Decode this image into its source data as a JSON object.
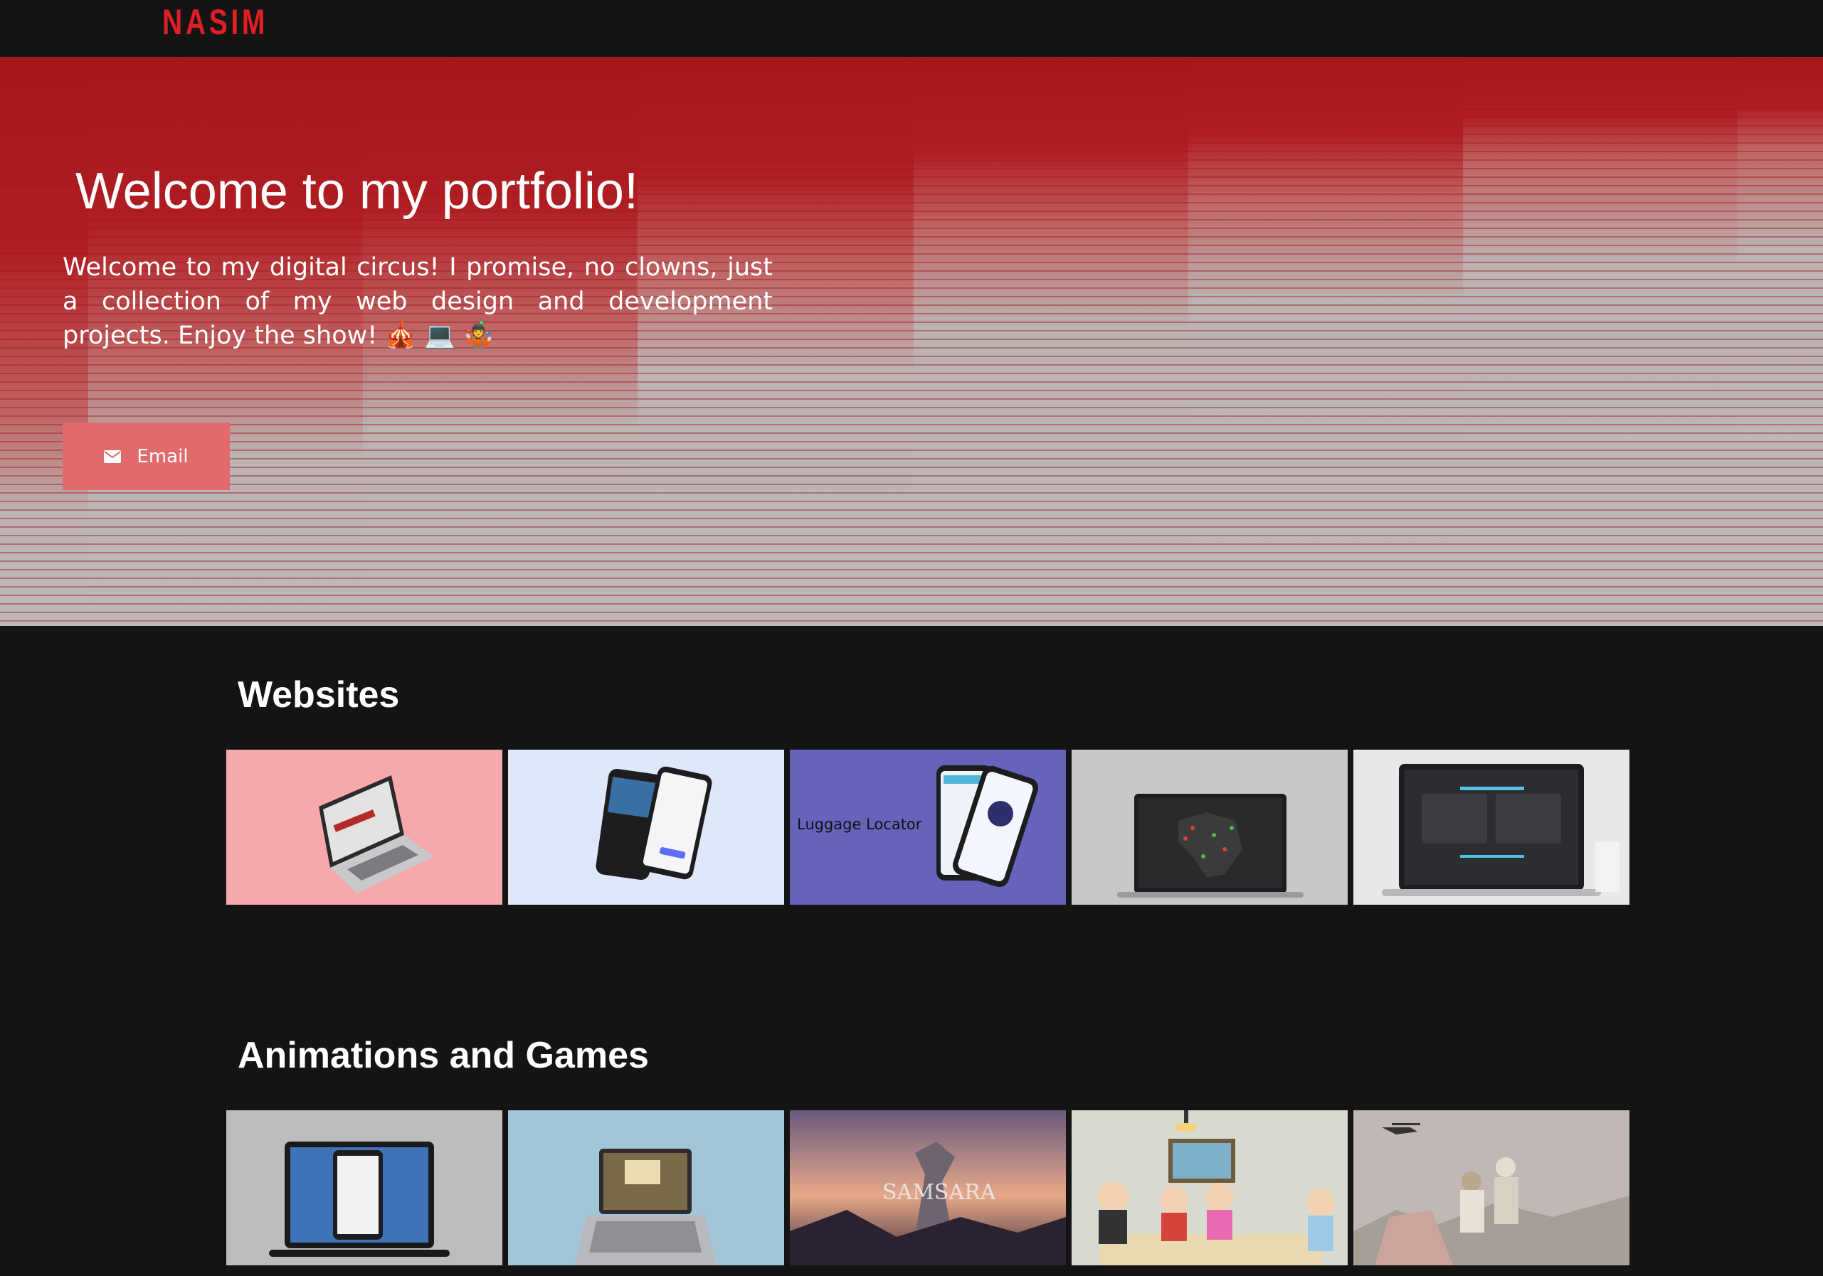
{
  "brand": {
    "logo": "NASIM"
  },
  "hero": {
    "title": "Welcome to my portfolio!",
    "text": "Welcome to my digital circus! I promise, no clowns, just a collection of my web design and development projects. Enjoy the show! 🎪 💻 🤹",
    "email_label": "Email",
    "email_icon": "envelope-icon"
  },
  "sections": [
    {
      "title": "Websites",
      "items": [
        {
          "name": "website-1",
          "bg": "#f7a8ad"
        },
        {
          "name": "website-2",
          "bg": "#dfe8f8"
        },
        {
          "name": "website-3",
          "bg": "#6762ba",
          "caption": "Luggage Locator"
        },
        {
          "name": "website-4",
          "bg": "#c8c8c8"
        },
        {
          "name": "website-5",
          "bg": "#e8e8e8"
        }
      ]
    },
    {
      "title": "Animations and Games",
      "items": [
        {
          "name": "game-1",
          "bg": "#bdbdbd"
        },
        {
          "name": "game-2",
          "bg": "#a3c5d8"
        },
        {
          "name": "game-3",
          "bg": "#5b4a5e",
          "caption": "SAMSARA"
        },
        {
          "name": "game-4",
          "bg": "#d8dacf"
        },
        {
          "name": "game-5",
          "bg": "#bfb8b4"
        }
      ]
    }
  ],
  "colors": {
    "accent": "#e01e24",
    "background": "#141414",
    "button": "#e06a6c"
  }
}
